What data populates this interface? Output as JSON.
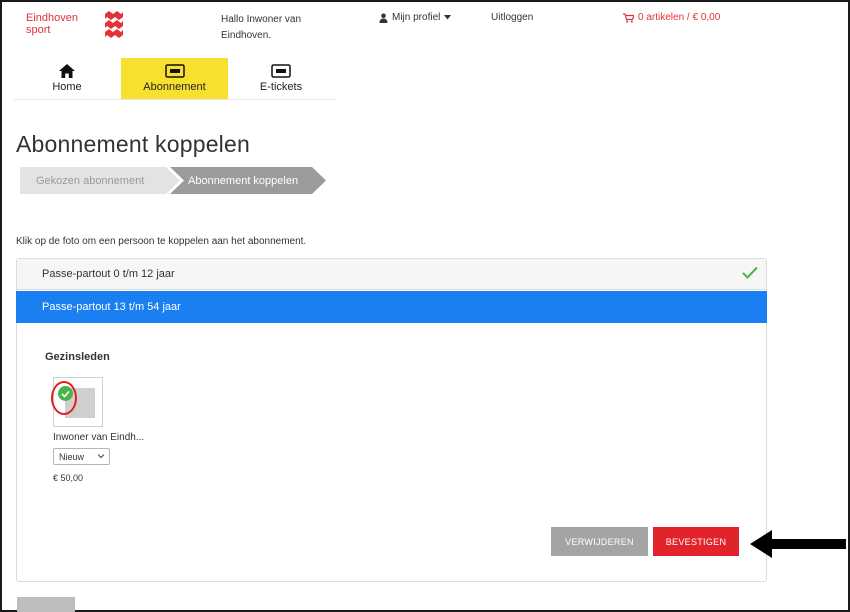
{
  "header": {
    "logo_line1": "Eindhoven",
    "logo_line2": "sport",
    "greeting_line1": "Hallo Inwoner van",
    "greeting_line2": "Eindhoven.",
    "profile_label": "Mijn profiel",
    "logout_label": "Uitloggen",
    "cart_label": "0 artikelen / € 0,00"
  },
  "nav": {
    "items": [
      {
        "label": "Home",
        "icon": "home-icon"
      },
      {
        "label": "Abonnement",
        "icon": "subscription-icon",
        "active": true
      },
      {
        "label": "E-tickets",
        "icon": "ticket-icon"
      }
    ]
  },
  "page": {
    "title": "Abonnement koppelen",
    "steps": [
      "Gekozen abonnement",
      "Abonnement koppelen"
    ],
    "instruction": "Klik op de foto om een persoon te koppelen aan het abonnement."
  },
  "subscriptions": [
    {
      "label": "Passe-partout 0 t/m 12 jaar",
      "completed": true
    },
    {
      "label": "Passe-partout 13 t/m 54 jaar",
      "active": true
    }
  ],
  "family": {
    "section_title": "Gezinsleden",
    "member": {
      "name": "Inwoner van Eindh...",
      "status": "Nieuw",
      "price": "€ 50,00"
    }
  },
  "actions": {
    "delete_label": "VERWIJDEREN",
    "confirm_label": "BEVESTIGEN"
  },
  "colors": {
    "brand_red": "#e2323a",
    "nav_active": "#f7e12e",
    "accordion_active": "#1a7ff0",
    "confirm": "#e2232b",
    "check_green": "#4ab44a"
  }
}
